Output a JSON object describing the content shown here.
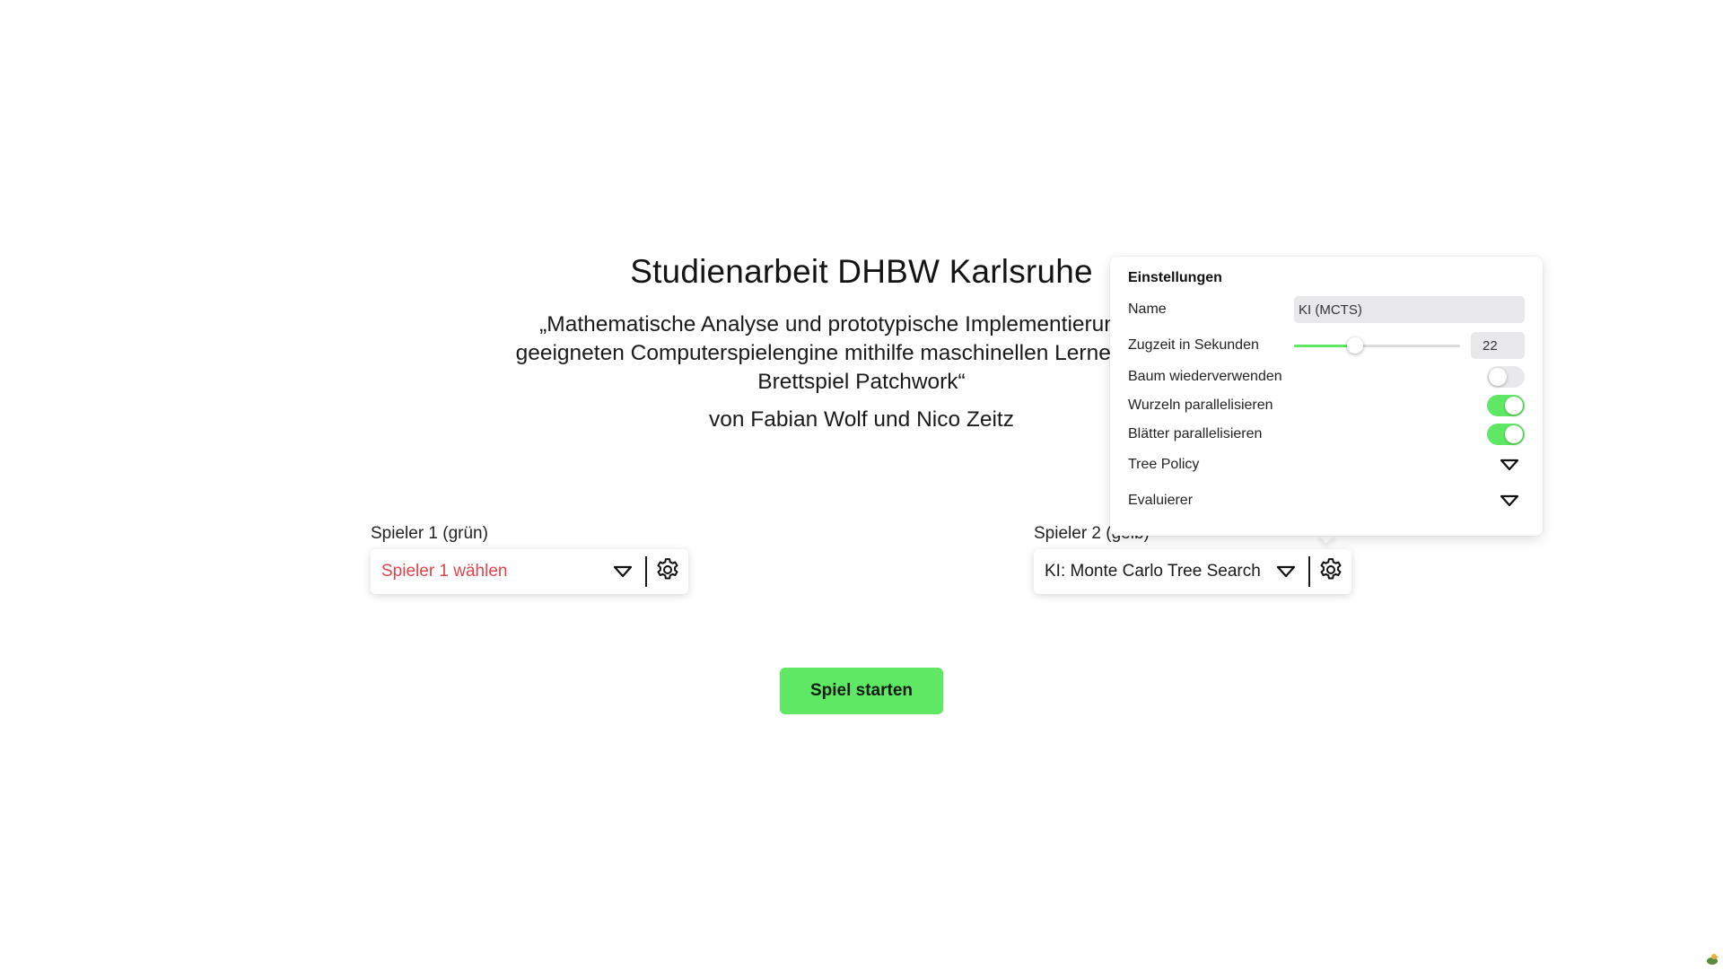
{
  "header": {
    "title": "Studienarbeit DHBW Karlsruhe",
    "subtitle_line1": "„Mathematische Analyse und prototypische Implementierung einer",
    "subtitle_line2": "geeigneten Computerspielengine mithilfe maschinellen Lernens für das",
    "subtitle_line3": "Brettspiel Patchwork“",
    "authors": "von Fabian Wolf und Nico Zeitz"
  },
  "player1": {
    "label": "Spieler 1 (grün)",
    "select_text": "Spieler 1 wählen",
    "select_is_placeholder": true,
    "chevron_icon": "triangle-down-icon",
    "settings_icon": "gear-icon"
  },
  "player2": {
    "label": "Spieler 2 (gelb)",
    "select_text": "KI: Monte Carlo Tree Search",
    "select_is_placeholder": false,
    "chevron_icon": "triangle-down-icon",
    "settings_icon": "gear-icon"
  },
  "start_button": {
    "label": "Spiel starten",
    "color": "#5fe864"
  },
  "settings": {
    "title": "Einstellungen",
    "name_label": "Name",
    "name_value": "KI (MCTS)",
    "time_label": "Zugzeit in Sekunden",
    "time_value": "22",
    "time_slider_fraction": 0.37,
    "reuse_tree_label": "Baum wiederverwenden",
    "reuse_tree_on": false,
    "root_parallel_label": "Wurzeln parallelisieren",
    "root_parallel_on": true,
    "leaf_parallel_label": "Blätter parallelisieren",
    "leaf_parallel_on": true,
    "tree_policy_label": "Tree Policy",
    "evaluator_label": "Evaluierer"
  },
  "colors": {
    "accent_green": "#5fe864",
    "placeholder_red": "#e2434b",
    "toggle_off": "#e9e9eb",
    "input_bg": "#e8e8ea"
  }
}
